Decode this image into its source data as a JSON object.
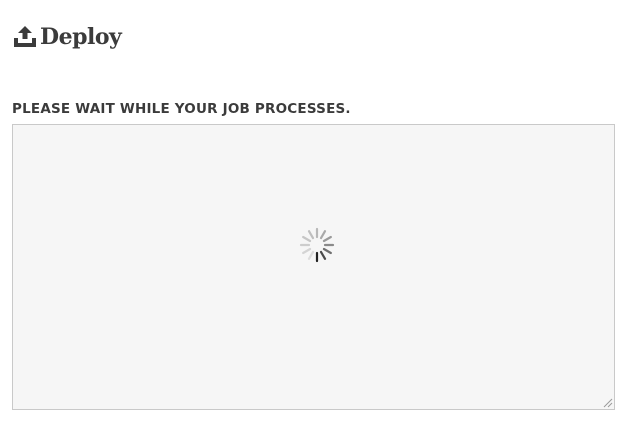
{
  "brand": {
    "name": "Deploy",
    "icon": "upload-tray-icon",
    "color": "#3b3b3b"
  },
  "status": {
    "heading": "PLEASE WAIT WHILE YOUR JOB PROCESSES."
  },
  "output": {
    "loading_icon": "loading-spinner-icon",
    "background": "#f6f6f6",
    "border_color": "#c9c9c9"
  }
}
